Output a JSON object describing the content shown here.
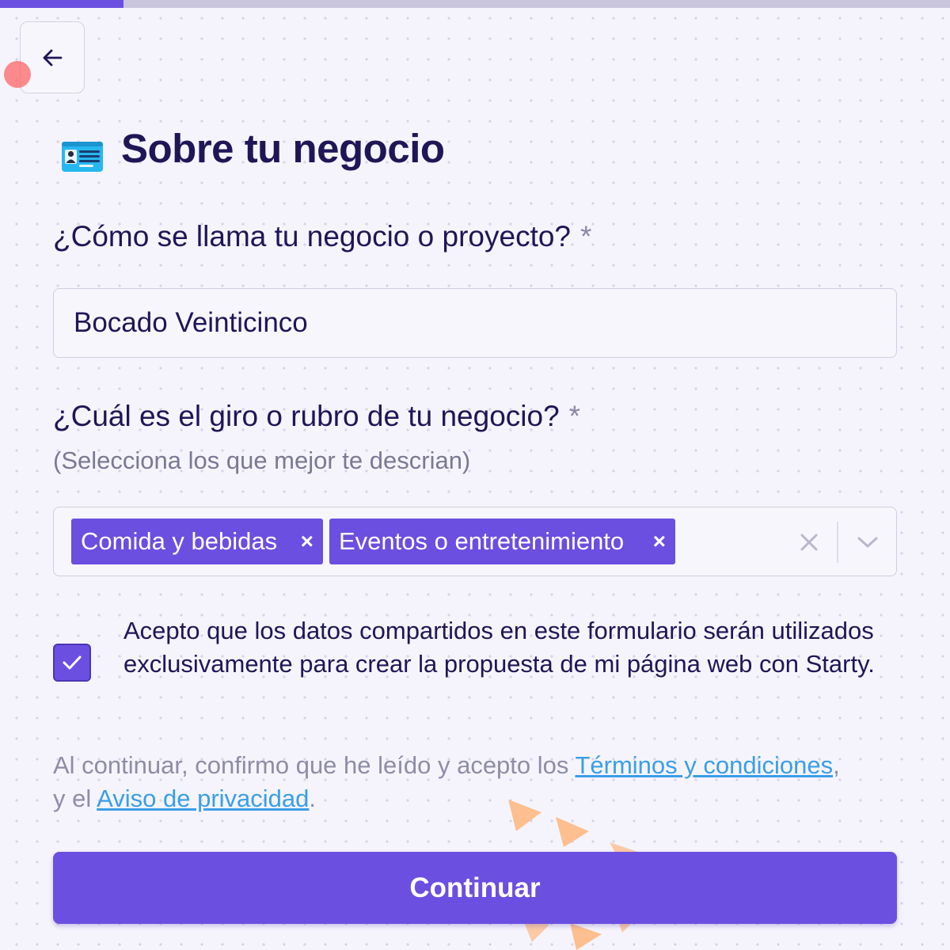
{
  "progress": {
    "fraction": 0.13,
    "fill_color": "#6a4fe0",
    "track_color": "#c9c6de"
  },
  "navigation": {
    "back_icon": "arrow-left-icon"
  },
  "page": {
    "title": "Sobre tu negocio",
    "title_icon": "id-card-icon"
  },
  "business_name": {
    "question": "¿Cómo se llama tu negocio o proyecto?",
    "required_mark": "*",
    "value": "Bocado Veinticinco"
  },
  "business_category": {
    "question": "¿Cuál es el giro o rubro de tu negocio?",
    "required_mark": "*",
    "hint": "(Selecciona los que mejor te descrian)",
    "selected": [
      {
        "label": "Comida y bebidas",
        "remove": "×"
      },
      {
        "label": "Eventos o entretenimiento",
        "remove": "×"
      }
    ],
    "clear_icon": "close-icon",
    "dropdown_icon": "chevron-down-icon"
  },
  "consent": {
    "checked": true,
    "text": "Acepto que los datos compartidos en este formulario serán utilizados exclusivamente para crear la propuesta de mi página web con Starty."
  },
  "terms": {
    "prefix": "Al continuar, confirmo que he leído y acepto los ",
    "terms_link": "Términos y condiciones",
    "middle": ", y el ",
    "privacy_link": "Aviso de privacidad",
    "suffix": "."
  },
  "actions": {
    "continue_label": "Continuar"
  },
  "colors": {
    "accent": "#6a4fe0",
    "title_text": "#1f1657",
    "link": "#3a9ee8",
    "muted_text": "#8e8ca6",
    "background": "#f5f4fc"
  }
}
